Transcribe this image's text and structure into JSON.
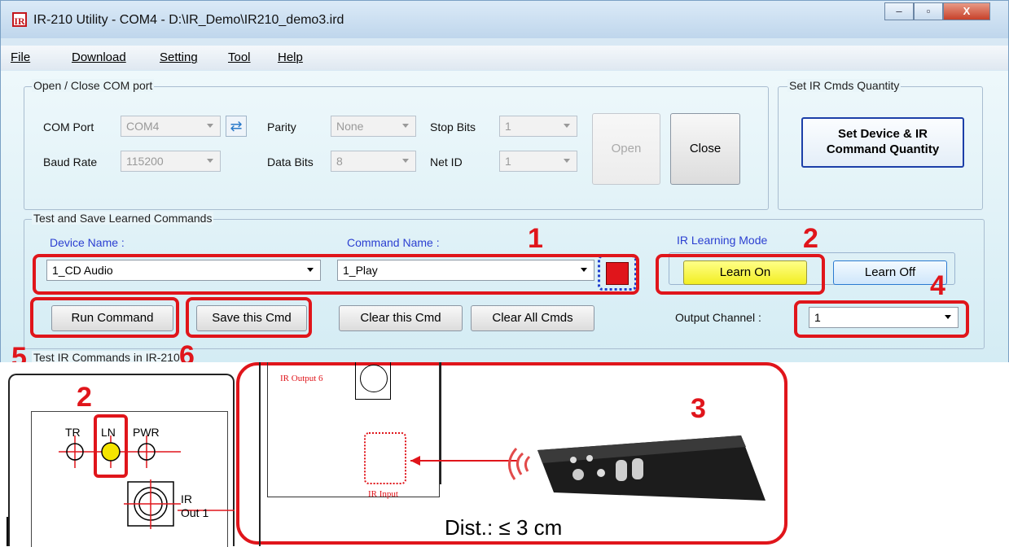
{
  "window": {
    "title": "IR-210 Utility - COM4 - D:\\IR_Demo\\IR210_demo3.ird",
    "app_icon_text": "IR",
    "controls": {
      "minimize": "–",
      "maximize": "▫",
      "close": "X"
    }
  },
  "menu": {
    "file": "File",
    "download": "Download",
    "setting": "Setting",
    "tool": "Tool",
    "help": "Help"
  },
  "com_group": {
    "title": "Open / Close COM port",
    "com_port_label": "COM Port",
    "com_port_value": "COM4",
    "baud_rate_label": "Baud Rate",
    "baud_rate_value": "115200",
    "parity_label": "Parity",
    "parity_value": "None",
    "data_bits_label": "Data Bits",
    "data_bits_value": "8",
    "stop_bits_label": "Stop Bits",
    "stop_bits_value": "1",
    "net_id_label": "Net ID",
    "net_id_value": "1",
    "open_label": "Open",
    "close_label": "Close"
  },
  "quantity_group": {
    "title": "Set IR Cmds Quantity",
    "button_line1": "Set Device & IR",
    "button_line2": "Command Quantity"
  },
  "test_group": {
    "title": "Test and Save Learned Commands",
    "device_name_label": "Device Name :",
    "device_name_value": "1_CD Audio",
    "command_name_label": "Command Name :",
    "command_name_value": "1_Play",
    "ir_learning_mode_label": "IR Learning Mode",
    "learn_on_label": "Learn On",
    "learn_off_label": "Learn Off",
    "run_command_label": "Run Command",
    "save_cmd_label": "Save this Cmd",
    "clear_cmd_label": "Clear this Cmd",
    "clear_all_label": "Clear All Cmds",
    "output_channel_label": "Output Channel :",
    "output_channel_value": "1"
  },
  "next_group_title_partial": "Test IR Commands in IR-210",
  "annotations": {
    "n1": "1",
    "n2": "2",
    "n3": "3",
    "n4": "4",
    "n5": "5",
    "n6": "6",
    "n2b": "2"
  },
  "hardware": {
    "tr": "TR",
    "ln": "LN",
    "pwr": "PWR",
    "ir": "IR",
    "out1": "Out 1",
    "ir_output6": "IR Output 6",
    "ir_input": "IR Input",
    "distance": "Dist.: ≤ 3 cm"
  },
  "colors": {
    "accent_red": "#e0151b",
    "learn_on_yellow": "#ffff55",
    "led_yellow": "#f5e400",
    "label_blue": "#2b3fd1"
  }
}
